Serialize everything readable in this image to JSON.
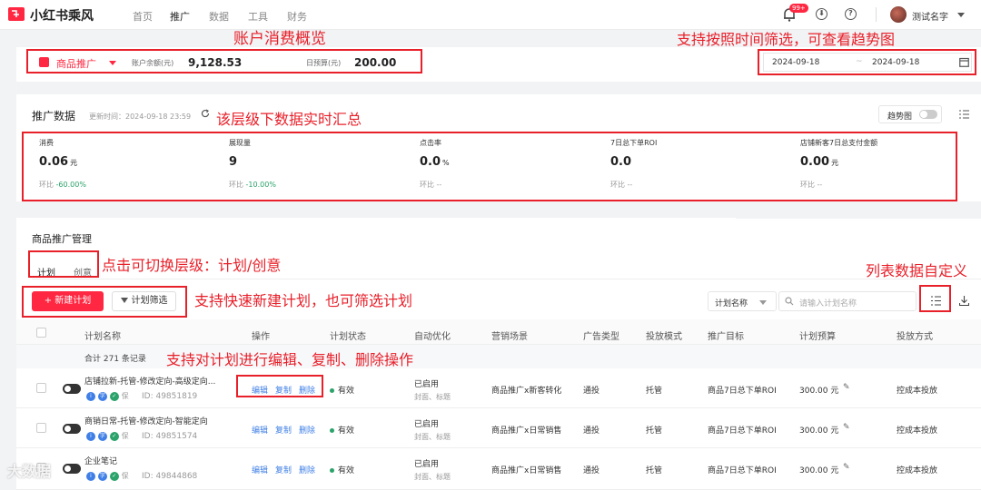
{
  "app": {
    "name": "小红书乘风",
    "nav": [
      "首页",
      "推广",
      "数据",
      "工具",
      "财务"
    ],
    "notification_count": "99+",
    "user_name": "测试名字"
  },
  "account": {
    "product_label": "商品推广",
    "balance_label": "账户余额(元)",
    "balance": "9,128.53",
    "daily_budget_label": "日预算(元)",
    "daily_budget": "200.00",
    "date_start": "2024-09-18",
    "date_end": "2024-09-18"
  },
  "stats": {
    "title": "推广数据",
    "updated": "更新时间：2024-09-18 23:59",
    "trend_label": "趋势图",
    "items": [
      {
        "label": "消费",
        "value": "0.06",
        "unit": "元",
        "change_label": "环比",
        "change": "-60.00%"
      },
      {
        "label": "展现量",
        "value": "9",
        "unit": "",
        "change_label": "环比",
        "change": "-10.00%"
      },
      {
        "label": "点击率",
        "value": "0.0",
        "unit": "%",
        "change_label": "环比",
        "change": "--"
      },
      {
        "label": "7日总下单ROI",
        "value": "0.0",
        "unit": "",
        "change_label": "环比",
        "change": "--"
      },
      {
        "label": "店铺新客7日总支付金额",
        "value": "0.00",
        "unit": "元",
        "change_label": "环比",
        "change": "--"
      }
    ]
  },
  "management": {
    "title": "商品推广管理",
    "tabs": [
      "计划",
      "创意"
    ],
    "new_button": "+ 新建计划",
    "filter_button": "计划筛选",
    "search_select": "计划名称",
    "search_placeholder": "请输入计划名称",
    "columns": [
      "计划名称",
      "操作",
      "计划状态",
      "自动优化",
      "营销场景",
      "广告类型",
      "投放模式",
      "推广目标",
      "计划预算",
      "投放方式"
    ],
    "total": "合计 271 条记录",
    "actions": [
      "编辑",
      "复制",
      "删除"
    ],
    "rows": [
      {
        "name": "店铺拉新-托管-修改定向-高级定向...",
        "id": "ID: 49851819",
        "status": "有效",
        "auto": "已启用",
        "auto_sub": "封面、标题",
        "scene": "商品推广x新客转化",
        "ad_type": "通投",
        "mode": "托管",
        "goal": "商品7日总下单ROI",
        "budget": "300.00 元",
        "delivery": "控成本投放"
      },
      {
        "name": "商销日常-托管-修改定向-智能定向",
        "id": "ID: 49851574",
        "status": "有效",
        "auto": "已启用",
        "auto_sub": "封面、标题",
        "scene": "商品推广x日常销售",
        "ad_type": "通投",
        "mode": "托管",
        "goal": "商品7日总下单ROI",
        "budget": "300.00 元",
        "delivery": "控成本投放"
      },
      {
        "name": "企业笔记",
        "id": "ID: 49844868",
        "status": "有效",
        "auto": "已启用",
        "auto_sub": "封面、标题",
        "scene": "商品推广x日常销售",
        "ad_type": "通投",
        "mode": "托管",
        "goal": "商品7日总下单ROI",
        "budget": "300.00 元",
        "delivery": "控成本投放"
      }
    ]
  },
  "annotations": {
    "account_overview": "账户消费概览",
    "time_filter": "支持按照时间筛选，可查看趋势图",
    "realtime": "该层级下数据实时汇总",
    "switch_level": "点击可切换层级：计划/创意",
    "custom_columns": "列表数据自定义",
    "new_plan": "支持快速新建计划，也可筛选计划",
    "row_ops": "支持对计划进行编辑、复制、删除操作"
  },
  "watermark": "大数据",
  "colors": {
    "brand": "#ff2741",
    "annotation": "#e8202a",
    "link": "#3f7fe6",
    "positive": "#2ba36a"
  }
}
